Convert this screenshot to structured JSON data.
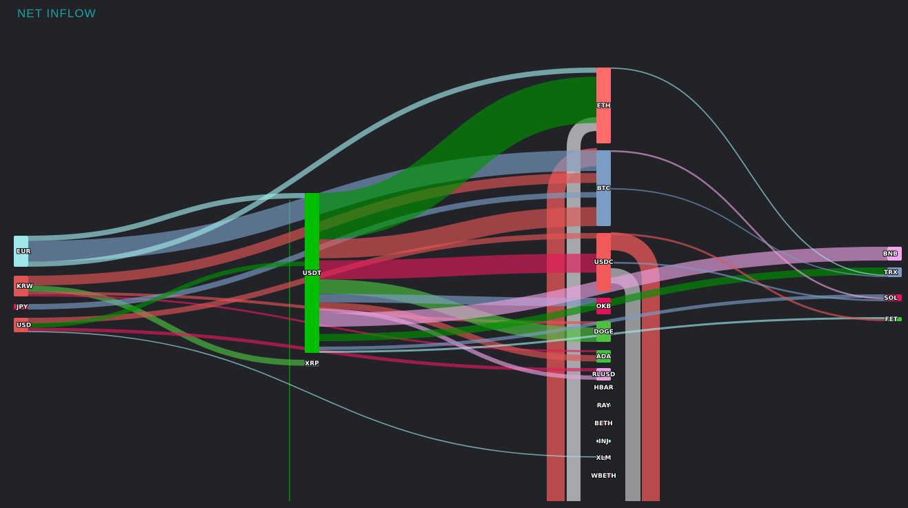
{
  "title": "NET INFLOW",
  "nodes": [
    {
      "id": "EUR",
      "label": "EUR",
      "color": "#9fe8ea"
    },
    {
      "id": "KRW",
      "label": "KRW",
      "color": "#e05555"
    },
    {
      "id": "JPY",
      "label": "JPY",
      "color": "#e01a5a"
    },
    {
      "id": "USD",
      "label": "USD",
      "color": "#e05555"
    },
    {
      "id": "USDT",
      "label": "USDT",
      "color": "#00c000"
    },
    {
      "id": "XRP",
      "label": "XRP",
      "color": "#4a4f5a"
    },
    {
      "id": "ETH",
      "label": "ETH",
      "color": "#ff6a6a"
    },
    {
      "id": "BTC",
      "label": "BTC",
      "color": "#7b9cc4"
    },
    {
      "id": "USDC",
      "label": "USDC",
      "color": "#f25a5a"
    },
    {
      "id": "OKB",
      "label": "OKB",
      "color": "#e0145a"
    },
    {
      "id": "DOGE",
      "label": "DOGE",
      "color": "#4fc040"
    },
    {
      "id": "ADA",
      "label": "ADA",
      "color": "#3cc83c"
    },
    {
      "id": "RLUSD",
      "label": "RLUSD",
      "color": "#e9a0e0"
    },
    {
      "id": "HBAR",
      "label": "HBAR",
      "color": "#3cc83c"
    },
    {
      "id": "RAY",
      "label": "RAY",
      "color": "#7b9cc4"
    },
    {
      "id": "BETH",
      "label": "BETH",
      "color": "#e05555"
    },
    {
      "id": "INJ",
      "label": "INJ",
      "color": "#9fe8ea"
    },
    {
      "id": "XLM",
      "label": "XLM",
      "color": "#e9a0e0"
    },
    {
      "id": "WBETH",
      "label": "WBETH",
      "color": "#e05555"
    },
    {
      "id": "BNB",
      "label": "BNB",
      "color": "#f0a8f0"
    },
    {
      "id": "TRX",
      "label": "TRX",
      "color": "#7b9cc4"
    },
    {
      "id": "SOL",
      "label": "SOL",
      "color": "#e0145a"
    },
    {
      "id": "FET",
      "label": "FET",
      "color": "#3cc83c"
    }
  ],
  "links": [
    {
      "source": "EUR",
      "target": "USDT",
      "value": 3,
      "color": "#9fe8ea"
    },
    {
      "source": "EUR",
      "target": "BTC",
      "value": 12,
      "color": "#7b9cc4"
    },
    {
      "source": "EUR",
      "target": "ETH",
      "value": 3,
      "color": "#9fe8ea"
    },
    {
      "source": "KRW",
      "target": "BTC",
      "value": 10,
      "color": "#e05555"
    },
    {
      "source": "KRW",
      "target": "XRP",
      "value": 6,
      "color": "#4fc040"
    },
    {
      "source": "KRW",
      "target": "DOGE",
      "value": 3,
      "color": "#e05555"
    },
    {
      "source": "KRW",
      "target": "ADA",
      "value": 2,
      "color": "#e01a5a"
    },
    {
      "source": "JPY",
      "target": "BTC",
      "value": 8,
      "color": "#7b9cc4"
    },
    {
      "source": "USD",
      "target": "USDC",
      "value": 5,
      "color": "#e05555"
    },
    {
      "source": "USD",
      "target": "USDT",
      "value": 4,
      "color": "#009000"
    },
    {
      "source": "USD",
      "target": "RLUSD",
      "value": 3,
      "color": "#e01a5a"
    },
    {
      "source": "USD",
      "target": "XLM",
      "value": 1,
      "color": "#9fe8ea"
    },
    {
      "source": "USDT",
      "target": "ETH",
      "value": 22,
      "color": "#009000"
    },
    {
      "source": "USDT",
      "target": "BTC",
      "value": 10,
      "color": "#e05555"
    },
    {
      "source": "USDT",
      "target": "USDC",
      "value": 9,
      "color": "#e01a5a"
    },
    {
      "source": "USDT",
      "target": "DOGE",
      "value": 7,
      "color": "#4fc040"
    },
    {
      "source": "USDT",
      "target": "OKB",
      "value": 4,
      "color": "#7b9cc4"
    },
    {
      "source": "USDT",
      "target": "ADA",
      "value": 3,
      "color": "#e05555"
    },
    {
      "source": "USDT",
      "target": "RLUSD",
      "value": 2,
      "color": "#e9a0e0"
    },
    {
      "source": "USDT",
      "target": "BNB",
      "value": 10,
      "color": "#e9a0e0"
    },
    {
      "source": "USDT",
      "target": "TRX",
      "value": 6,
      "color": "#009000"
    },
    {
      "source": "USDT",
      "target": "SOL",
      "value": 2,
      "color": "#7b9cc4"
    },
    {
      "source": "USDT",
      "target": "FET",
      "value": 1,
      "color": "#9fe8ea"
    },
    {
      "source": "ETH",
      "target": "TRX",
      "value": 1,
      "color": "#9fe8ea"
    },
    {
      "source": "BTC",
      "target": "SOL",
      "value": 1,
      "color": "#e9a0e0"
    },
    {
      "source": "BTC",
      "target": "TRX",
      "value": 1,
      "color": "#7b9cc4"
    },
    {
      "source": "USDC",
      "target": "FET",
      "value": 1,
      "color": "#e05555"
    },
    {
      "source": "USDC",
      "target": "SOL",
      "value": 1,
      "color": "#7b9cc4"
    }
  ]
}
